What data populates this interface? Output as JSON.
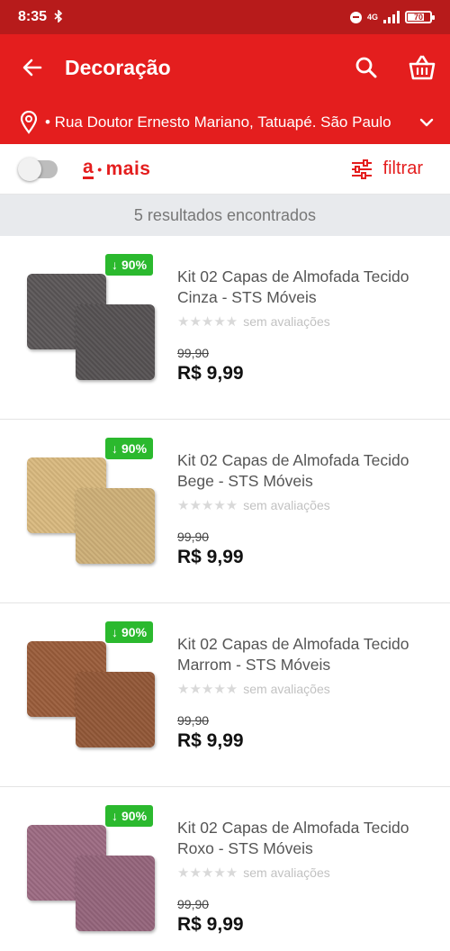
{
  "status_bar": {
    "time": "8:35",
    "bluetooth_icon": "bluetooth-icon",
    "network": "4G",
    "battery": "70",
    "battery_level_percent": 70
  },
  "app_bar": {
    "title": "Decoração",
    "back_icon": "arrow-left-icon",
    "search_icon": "search-icon",
    "cart_icon": "basket-icon"
  },
  "address": {
    "text": "• Rua Doutor Ernesto Mariano, Tatuapé. São Paulo",
    "pin_icon": "location-pin-icon",
    "chevron_icon": "chevron-down-icon"
  },
  "filter_bar": {
    "toggle_on": false,
    "brand_a": "a",
    "brand_mais": "mais",
    "filter_label": "filtrar",
    "filter_icon": "sliders-icon"
  },
  "results_text": "5 resultados encontrados",
  "colors": {
    "brand_red": "#e41e1e",
    "status_bar": "#b71b1b",
    "discount_green": "#2bb92e"
  },
  "products": [
    {
      "name": "Kit 02 Capas de Almofada Tecido Cinza - STS Móveis",
      "discount": "90%",
      "rating_text": "sem avaliações",
      "old_price": "99,90",
      "price": "R$ 9,99",
      "color": "#5a5657"
    },
    {
      "name": "Kit 02 Capas de Almofada Tecido Bege - STS Móveis",
      "discount": "90%",
      "rating_text": "sem avaliações",
      "old_price": "99,90",
      "price": "R$ 9,99",
      "color": "#d9b97e"
    },
    {
      "name": "Kit 02 Capas de Almofada Tecido Marrom - STS Móveis",
      "discount": "90%",
      "rating_text": "sem avaliações",
      "old_price": "99,90",
      "price": "R$ 9,99",
      "color": "#9a5c3a"
    },
    {
      "name": "Kit 02 Capas de Almofada Tecido Roxo - STS Móveis",
      "discount": "90%",
      "rating_text": "sem avaliações",
      "old_price": "99,90",
      "price": "R$ 9,99",
      "color": "#9c6a82"
    }
  ]
}
